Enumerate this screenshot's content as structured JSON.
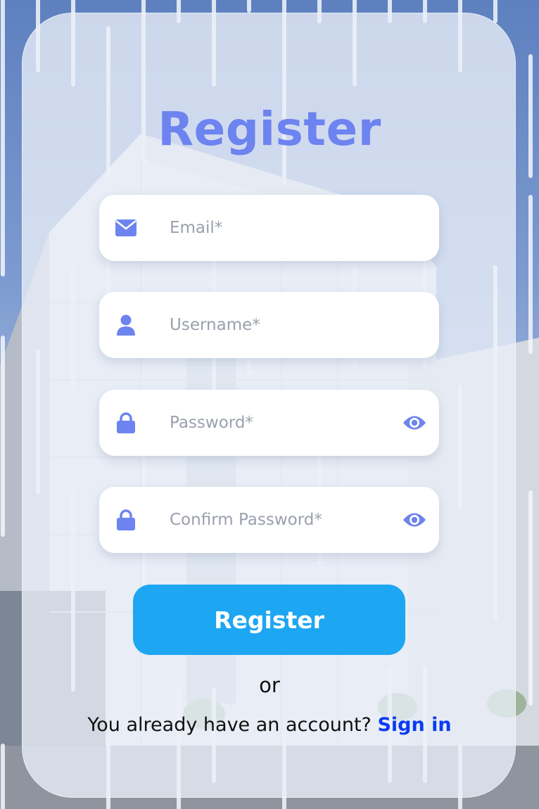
{
  "title": "Register",
  "fields": {
    "email": {
      "placeholder": "Email*",
      "value": "",
      "icon": "envelope-icon"
    },
    "username": {
      "placeholder": "Username*",
      "value": "",
      "icon": "user-icon"
    },
    "password": {
      "placeholder": "Password*",
      "value": "",
      "icon": "lock-icon",
      "toggle_icon": "eye-icon"
    },
    "confirm_password": {
      "placeholder": "Confirm Password*",
      "value": "",
      "icon": "lock-icon",
      "toggle_icon": "eye-icon"
    }
  },
  "register_button": "Register",
  "separator": "or",
  "signin": {
    "prompt": "You already have an account?",
    "link": "Sign in"
  },
  "colors": {
    "accent": "#6d83f0",
    "button": "#1da6f2",
    "link": "#0b3bf2",
    "card": "#ebf0f8"
  }
}
